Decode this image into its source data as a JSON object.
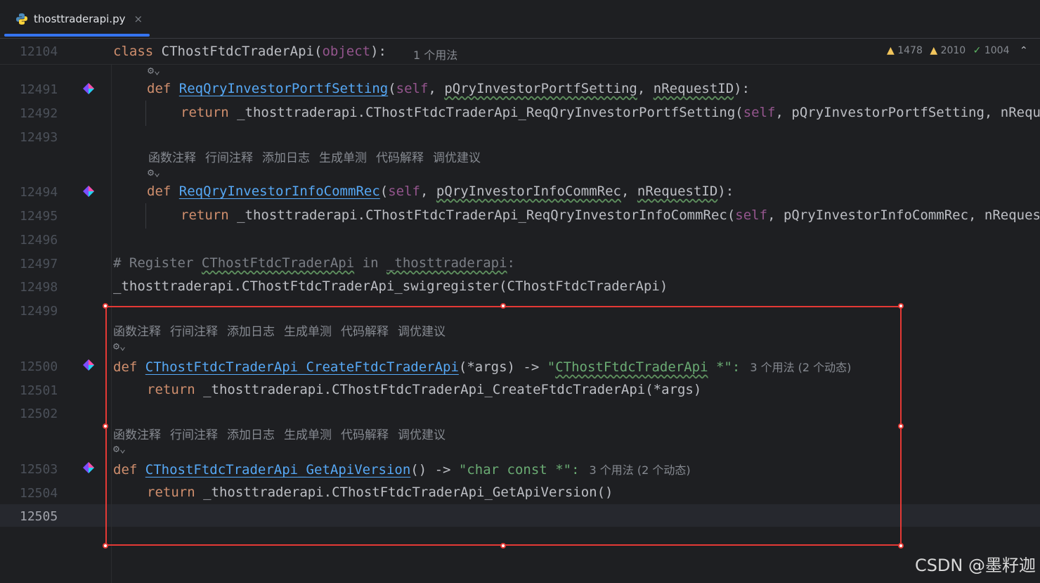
{
  "tab": {
    "filename": "thosttraderapi.py",
    "close": "×"
  },
  "sticky": {
    "line_number": "12104",
    "code": {
      "kw": "class",
      "name": "CThostFtdcTraderApi",
      "open": "(",
      "base": "object",
      "close": "):"
    },
    "usage_hint": "1 个用法"
  },
  "inspections": {
    "warnings": "1478",
    "weak_warnings": "2010",
    "typos": "1004"
  },
  "lens_actions": [
    "函数注释",
    "行间注释",
    "添加日志",
    "生成单测",
    "代码解释",
    "调优建议"
  ],
  "lines": {
    "l12491": {
      "num": "12491",
      "kw": "def",
      "fn": "ReqQryInvestorPortfSetting",
      "p1": "(",
      "self": "self",
      "sep": ", ",
      "a1": "pQryInvestorPortfSetting",
      "sep2": ", ",
      "a2": "nRequestID",
      "end": "):"
    },
    "l12492": {
      "num": "12492",
      "kw": "return",
      "body": " _thosttraderapi.CThostFtdcTraderApi_ReqQryInvestorPortfSetting(",
      "self": "self",
      "rest": ", pQryInvestorPortfSetting, nRequestID)"
    },
    "l12493": {
      "num": "12493"
    },
    "l12494": {
      "num": "12494",
      "kw": "def",
      "fn": "ReqQryInvestorInfoCommRec",
      "p1": "(",
      "self": "self",
      "sep": ", ",
      "a1": "pQryInvestorInfoCommRec",
      "sep2": ", ",
      "a2": "nRequestID",
      "end": "):"
    },
    "l12495": {
      "num": "12495",
      "kw": "return",
      "body": " _thosttraderapi.CThostFtdcTraderApi_ReqQryInvestorInfoCommRec(",
      "self": "self",
      "rest": ", pQryInvestorInfoCommRec, nRequestID)"
    },
    "l12496": {
      "num": "12496"
    },
    "l12497": {
      "num": "12497",
      "c1": "# Register ",
      "c2": "CThostFtdcTraderApi",
      "c3": " in ",
      "c4": "_thosttraderapi",
      "c5": ":"
    },
    "l12498": {
      "num": "12498",
      "code": "_thosttraderapi.CThostFtdcTraderApi_swigregister(CThostFtdcTraderApi)"
    },
    "l12499": {
      "num": "12499"
    },
    "l12500": {
      "num": "12500",
      "kw": "def",
      "fn": "CThostFtdcTraderApi_CreateFtdcTraderApi",
      "args": "(*args) -> ",
      "q1": "\"",
      "ret": "CThostFtdcTraderApi",
      "q2": " *\":",
      "hint": "3 个用法 (2 个动态)"
    },
    "l12501": {
      "num": "12501",
      "kw": "return",
      "body": " _thosttraderapi.CThostFtdcTraderApi_CreateFtdcTraderApi(*args)"
    },
    "l12502": {
      "num": "12502"
    },
    "l12503": {
      "num": "12503",
      "kw": "def",
      "fn": "CThostFtdcTraderApi_GetApiVersion",
      "args": "() -> ",
      "ret": "\"char const *\":",
      "hint": "3 个用法 (2 个动态)"
    },
    "l12504": {
      "num": "12504",
      "kw": "return",
      "body": " _thosttraderapi.CThostFtdcTraderApi_GetApiVersion()"
    },
    "l12505": {
      "num": "12505"
    }
  },
  "colors": {
    "keyword": "#cf8e6d",
    "function": "#56a8f5",
    "self": "#94558d",
    "string": "#6aab73",
    "selection": "#e53935",
    "accent": "#3574f0"
  },
  "icons": {
    "file": "python-icon",
    "ai": "ai-assistant-icon",
    "gutter": "implemented-method-icon",
    "warning": "warning-icon",
    "typo": "checkmark-icon"
  },
  "watermark": "CSDN @墨籽迦"
}
